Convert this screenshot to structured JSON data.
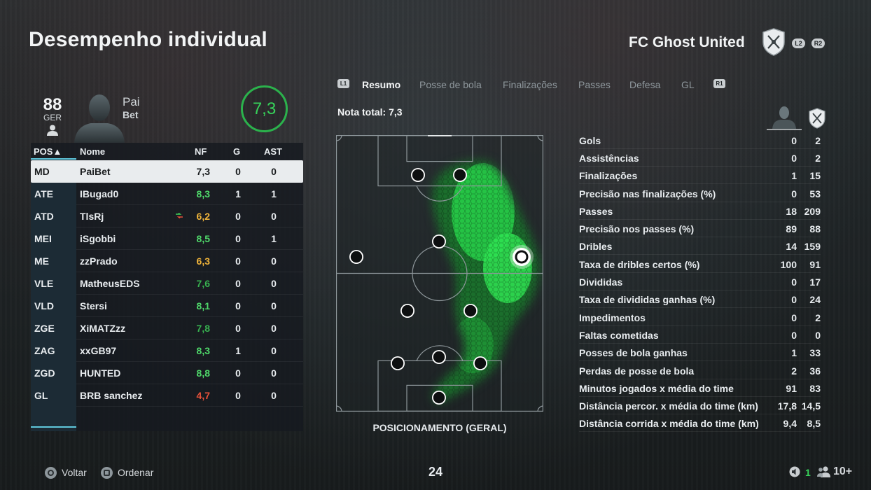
{
  "page_title": "Desempenho individual",
  "team": {
    "name": "FC Ghost United",
    "l2": "L2",
    "r2": "R2"
  },
  "player": {
    "overall": "88",
    "nation": "GER",
    "name_line1": "Pai",
    "name_line2": "Bet",
    "match_rating": "7,3"
  },
  "roster_table": {
    "headers": {
      "pos": "POS▲",
      "name": "Nome",
      "nf": "NF",
      "g": "G",
      "ast": "AST"
    },
    "rows": [
      {
        "pos": "MD",
        "name": "PaiBet",
        "nf": "7,3",
        "g": "0",
        "ast": "0",
        "nf_color": "#1a1d1f",
        "selected": true
      },
      {
        "pos": "ATE",
        "name": "IBugad0",
        "nf": "8,3",
        "g": "1",
        "ast": "1",
        "nf_color": "#4fd86a"
      },
      {
        "pos": "ATD",
        "name": "TlsRj",
        "nf": "6,2",
        "g": "0",
        "ast": "0",
        "nf_color": "#f0b43a",
        "substituted": true
      },
      {
        "pos": "MEI",
        "name": "iSgobbi",
        "nf": "8,5",
        "g": "0",
        "ast": "1",
        "nf_color": "#4fd86a"
      },
      {
        "pos": "ME",
        "name": "zzPrado",
        "nf": "6,3",
        "g": "0",
        "ast": "0",
        "nf_color": "#f0b43a"
      },
      {
        "pos": "VLE",
        "name": "MatheusEDS",
        "nf": "7,6",
        "g": "0",
        "ast": "0",
        "nf_color": "#37b04f"
      },
      {
        "pos": "VLD",
        "name": "Stersi",
        "nf": "8,1",
        "g": "0",
        "ast": "0",
        "nf_color": "#4fd86a"
      },
      {
        "pos": "ZGE",
        "name": "XiMATZzz",
        "nf": "7,8",
        "g": "0",
        "ast": "0",
        "nf_color": "#37b04f"
      },
      {
        "pos": "ZAG",
        "name": "xxGB97",
        "nf": "8,3",
        "g": "1",
        "ast": "0",
        "nf_color": "#4fd86a"
      },
      {
        "pos": "ZGD",
        "name": "HUNTED",
        "nf": "8,8",
        "g": "0",
        "ast": "0",
        "nf_color": "#4fd86a"
      },
      {
        "pos": "GL",
        "name": "BRB sanchez",
        "nf": "4,7",
        "g": "0",
        "ast": "0",
        "nf_color": "#e8513a"
      }
    ]
  },
  "tabs": {
    "l1": "L1",
    "r1": "R1",
    "items": [
      "Resumo",
      "Posse de bola",
      "Finalizações",
      "Passes",
      "Defesa",
      "GL"
    ],
    "active": "Resumo"
  },
  "nota_total": "Nota total: 7,3",
  "pitch_caption": "POSICIONAMENTO (GERAL)",
  "stats": [
    {
      "label": "Gols",
      "player": "0",
      "team": "2"
    },
    {
      "label": "Assistências",
      "player": "0",
      "team": "2"
    },
    {
      "label": "Finalizações",
      "player": "1",
      "team": "15"
    },
    {
      "label": "Precisão nas finalizações (%)",
      "player": "0",
      "team": "53"
    },
    {
      "label": "Passes",
      "player": "18",
      "team": "209"
    },
    {
      "label": "Precisão nos passes (%)",
      "player": "89",
      "team": "88"
    },
    {
      "label": "Dribles",
      "player": "14",
      "team": "159"
    },
    {
      "label": "Taxa de dribles certos (%)",
      "player": "100",
      "team": "91"
    },
    {
      "label": "Divididas",
      "player": "0",
      "team": "17"
    },
    {
      "label": "Taxa de divididas ganhas (%)",
      "player": "0",
      "team": "24"
    },
    {
      "label": "Impedimentos",
      "player": "0",
      "team": "2"
    },
    {
      "label": "Faltas cometidas",
      "player": "0",
      "team": "0"
    },
    {
      "label": "Posses de bola ganhas",
      "player": "1",
      "team": "33"
    },
    {
      "label": "Perdas de posse de bola",
      "player": "2",
      "team": "36"
    },
    {
      "label": "Minutos jogados x média do time",
      "player": "91",
      "team": "83"
    },
    {
      "label": "Distância percor. x média do time (km)",
      "player": "17,8",
      "team": "14,5"
    },
    {
      "label": "Distância corrida x média do time (km)",
      "player": "9,4",
      "team": "8,5"
    }
  ],
  "footer": {
    "back": "Voltar",
    "sort": "Ordenar",
    "page": "24",
    "party_count": "1",
    "players_count": "10+"
  },
  "colors": {
    "accent": "#5fc7dc",
    "rating_ring": "#2bb24c",
    "heatmap": "#27e04d"
  },
  "icons": [
    "person-icon",
    "team-crest-icon",
    "player-silhouette-icon",
    "substitution-icon",
    "circle-button-icon",
    "square-button-icon",
    "speaker-icon",
    "group-icon"
  ]
}
